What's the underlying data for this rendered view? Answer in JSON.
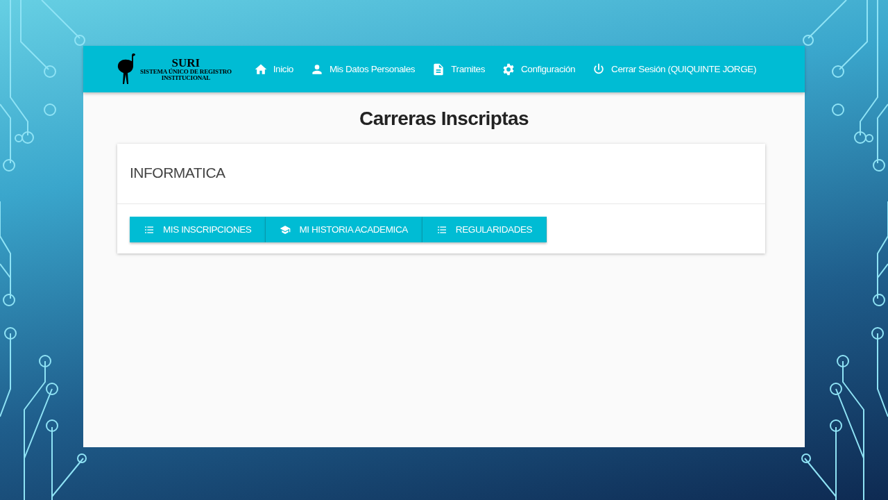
{
  "logo": {
    "title": "SURI",
    "subtitle_1": "SISTEMA ÚNICO DE REGISTRO",
    "subtitle_2": "INSTITUCIONAL"
  },
  "nav": [
    {
      "kind": "home",
      "label": "Inicio"
    },
    {
      "kind": "person",
      "label": "Mis Datos Personales"
    },
    {
      "kind": "document",
      "label": "Tramites"
    },
    {
      "kind": "gear",
      "label": "Configuración"
    },
    {
      "kind": "power",
      "label": "Cerrar Sesión (QUIQUINTE JORGE)"
    }
  ],
  "page_title": "Carreras Inscriptas",
  "career": {
    "name": "INFORMATICA",
    "buttons": [
      {
        "kind": "list",
        "label": "MIS INSCRIPCIONES"
      },
      {
        "kind": "school",
        "label": "MI HISTORIA ACADEMICA"
      },
      {
        "kind": "list",
        "label": "REGULARIDADES"
      }
    ]
  }
}
